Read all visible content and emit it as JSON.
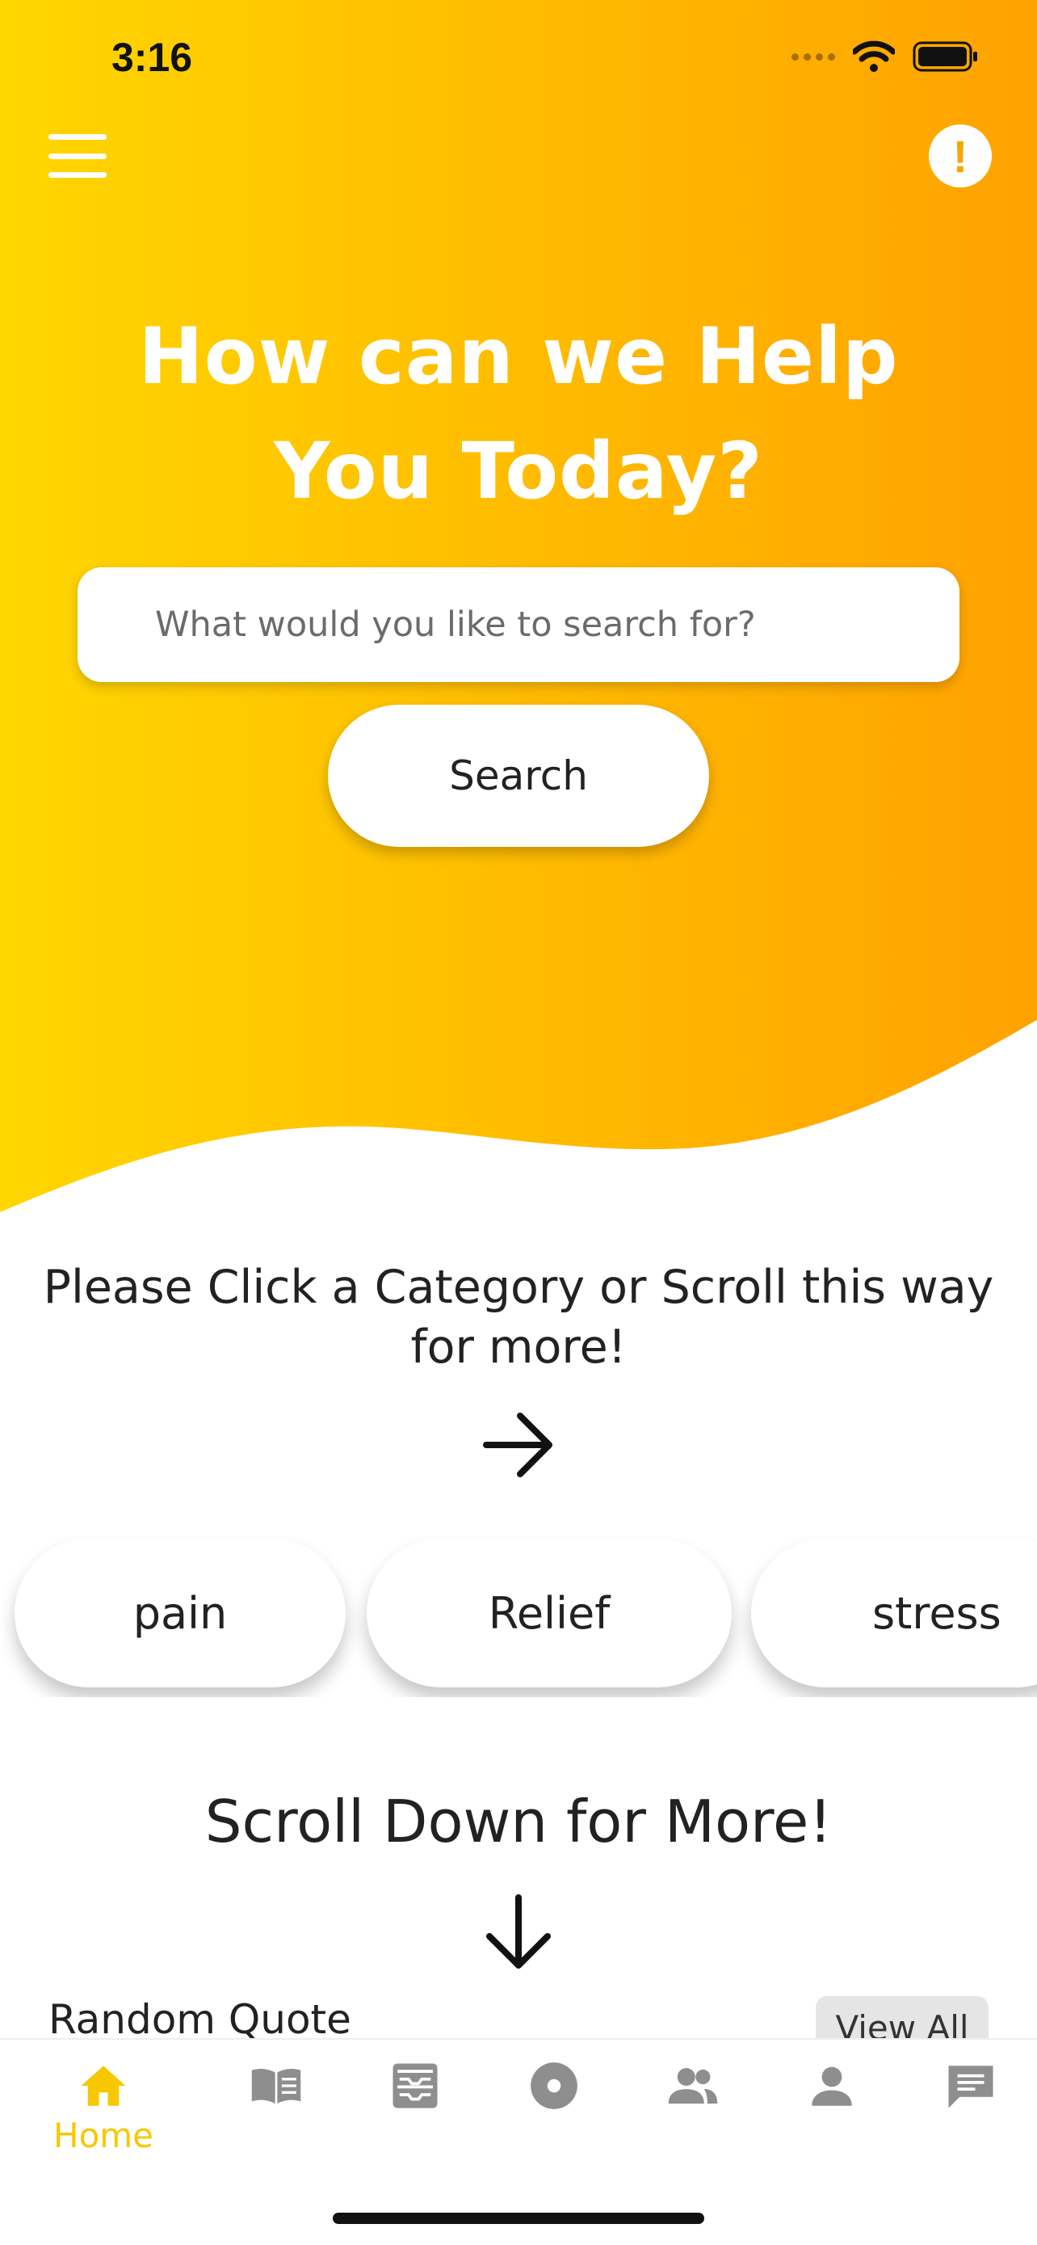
{
  "status_bar": {
    "time": "3:16"
  },
  "header": {
    "menu_icon": "hamburger-menu-icon",
    "info_icon": "info-icon",
    "info_glyph": "!"
  },
  "hero": {
    "title": "How can we Help You Today?",
    "search_placeholder": "What would you like to search for?",
    "search_button": "Search",
    "gradient": [
      "#ffd600",
      "#ffa200"
    ]
  },
  "categories": {
    "heading": "Please Click a Category or Scroll this way for more!",
    "items": [
      "pain",
      "Relief",
      "stress"
    ]
  },
  "scroll_hint": "Scroll Down for More!",
  "random_quote": {
    "title": "Random Quote",
    "view_all": "View All"
  },
  "tab_bar": {
    "active_color": "#f7c800",
    "inactive_color": "#8e8e8e",
    "tabs": [
      {
        "icon": "home-icon",
        "label": "Home",
        "active": true
      },
      {
        "icon": "book-icon",
        "label": "",
        "active": false
      },
      {
        "icon": "inbox-icon",
        "label": "",
        "active": false
      },
      {
        "icon": "disc-icon",
        "label": "",
        "active": false
      },
      {
        "icon": "people-icon",
        "label": "",
        "active": false
      },
      {
        "icon": "person-icon",
        "label": "",
        "active": false
      },
      {
        "icon": "chat-icon",
        "label": "",
        "active": false
      }
    ]
  }
}
